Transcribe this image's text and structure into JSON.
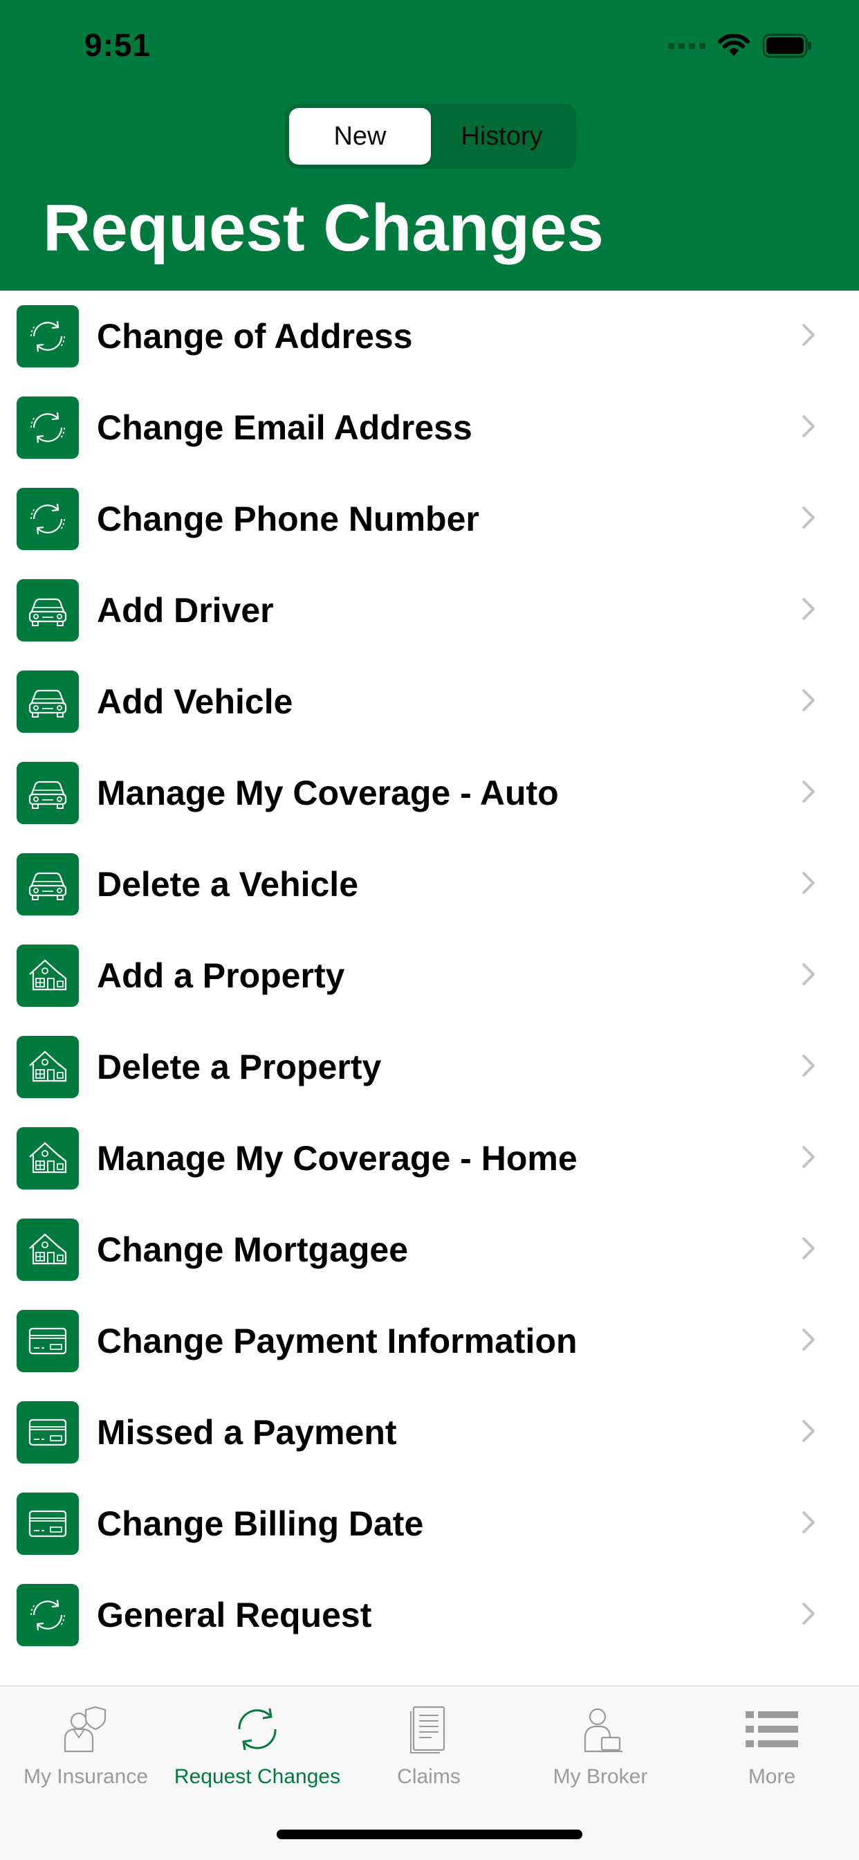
{
  "status_bar": {
    "time": "9:51"
  },
  "segment": {
    "new_label": "New",
    "history_label": "History",
    "selected": "New"
  },
  "page_title": "Request Changes",
  "items": [
    {
      "label": "Change of Address",
      "icon": "refresh-icon"
    },
    {
      "label": "Change Email Address",
      "icon": "refresh-icon"
    },
    {
      "label": "Change Phone Number",
      "icon": "refresh-icon"
    },
    {
      "label": "Add Driver",
      "icon": "car-icon"
    },
    {
      "label": "Add Vehicle",
      "icon": "car-icon"
    },
    {
      "label": "Manage My Coverage - Auto",
      "icon": "car-icon"
    },
    {
      "label": "Delete a Vehicle",
      "icon": "car-icon"
    },
    {
      "label": "Add a Property",
      "icon": "house-icon"
    },
    {
      "label": "Delete a Property",
      "icon": "house-icon"
    },
    {
      "label": "Manage My Coverage - Home",
      "icon": "house-icon"
    },
    {
      "label": "Change Mortgagee",
      "icon": "house-icon"
    },
    {
      "label": "Change Payment Information",
      "icon": "credit-card-icon"
    },
    {
      "label": "Missed a Payment",
      "icon": "credit-card-icon"
    },
    {
      "label": "Change Billing Date",
      "icon": "credit-card-icon"
    },
    {
      "label": "General Request",
      "icon": "refresh-icon"
    }
  ],
  "tabbar": {
    "tabs": [
      {
        "label": "My Insurance",
        "icon": "person-shield-icon",
        "active": false
      },
      {
        "label": "Request Changes",
        "icon": "refresh-icon",
        "active": true
      },
      {
        "label": "Claims",
        "icon": "document-icon",
        "active": false
      },
      {
        "label": "My Broker",
        "icon": "broker-person-icon",
        "active": false
      },
      {
        "label": "More",
        "icon": "list-icon",
        "active": false
      }
    ]
  },
  "colors": {
    "brand_green": "#007a3d",
    "inactive_gray": "#9b9b9b",
    "chevron_gray": "#c4c4c7"
  }
}
